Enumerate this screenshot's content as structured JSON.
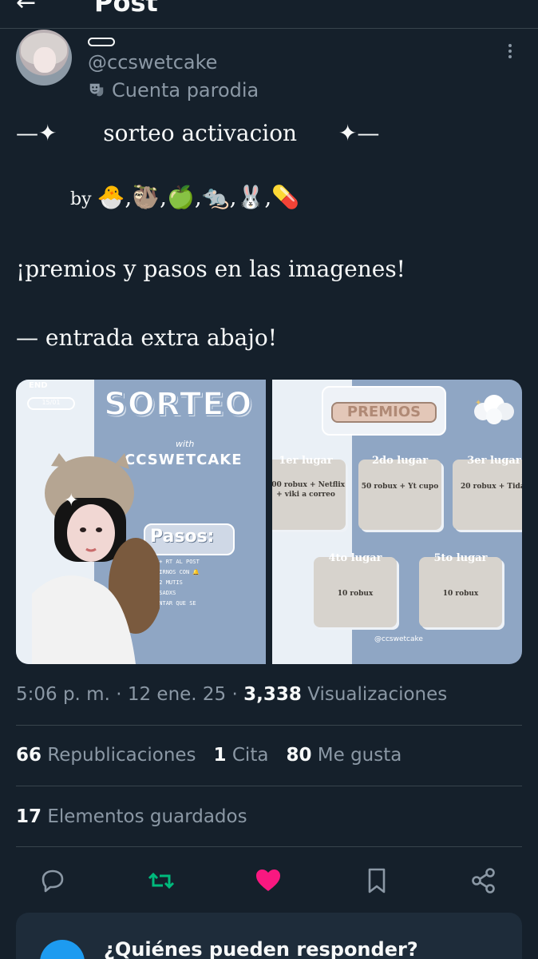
{
  "header": {
    "back_label": "←",
    "title": "Post"
  },
  "author": {
    "handle": "@ccswetcake",
    "label_text": "Cuenta parodia"
  },
  "post": {
    "line1_left_deco": "—✦",
    "line1_title": "sorteo activacion",
    "line1_right_deco": "✦—",
    "line2_by": "by",
    "line2_emojis": "🐣,🦥,🍏,🐀,🐰,💊",
    "line3": "¡premios y pasos en las imagenes!",
    "line4": "— entrada extra abajo!"
  },
  "media": {
    "image1": {
      "corner_tag": "END",
      "date": "15/01",
      "heading": "SORTEO",
      "with": "with",
      "brand": "CCSWETCAKE",
      "pasos_title": "Pasos:",
      "steps": [
        "1.FAV + RT AL POST",
        "2.SEGUIRNOS CON 🔔",
        "3.@ A 2 MUTIS",
        "INTERESADXS",
        "4.COMENTAR QUE SE",
        "ABAJO"
      ]
    },
    "image2": {
      "heading": "PREMIOS",
      "prizes": [
        {
          "place": "1er lugar",
          "prize": "100 robux + Netflix + viki a correo"
        },
        {
          "place": "2do lugar",
          "prize": "50 robux + Yt cupo"
        },
        {
          "place": "3er lugar",
          "prize": "20 robux + Tidal"
        },
        {
          "place": "4to lugar",
          "prize": "10 robux"
        },
        {
          "place": "5to lugar",
          "prize": "10 robux"
        }
      ],
      "watermark": "@ccswetcake"
    }
  },
  "meta": {
    "time": "5:06 p. m.",
    "sep1": "·",
    "date": "12 ene. 25",
    "sep2": "·",
    "views_count": "3,338",
    "views_label": "Visualizaciones"
  },
  "stats": {
    "reposts_count": "66",
    "reposts_label": "Republicaciones",
    "quotes_count": "1",
    "quotes_label": "Cita",
    "likes_count": "80",
    "likes_label": "Me gusta"
  },
  "saved": {
    "count": "17",
    "label": "Elementos guardados"
  },
  "reply_card": {
    "title": "¿Quiénes pueden responder?"
  },
  "colors": {
    "background": "#15202b",
    "text_primary": "#f7f9f9",
    "text_secondary": "#8b98a5",
    "repost_green": "#00ba7c",
    "like_pink": "#f91880",
    "accent_blue": "#1d9bf0"
  }
}
